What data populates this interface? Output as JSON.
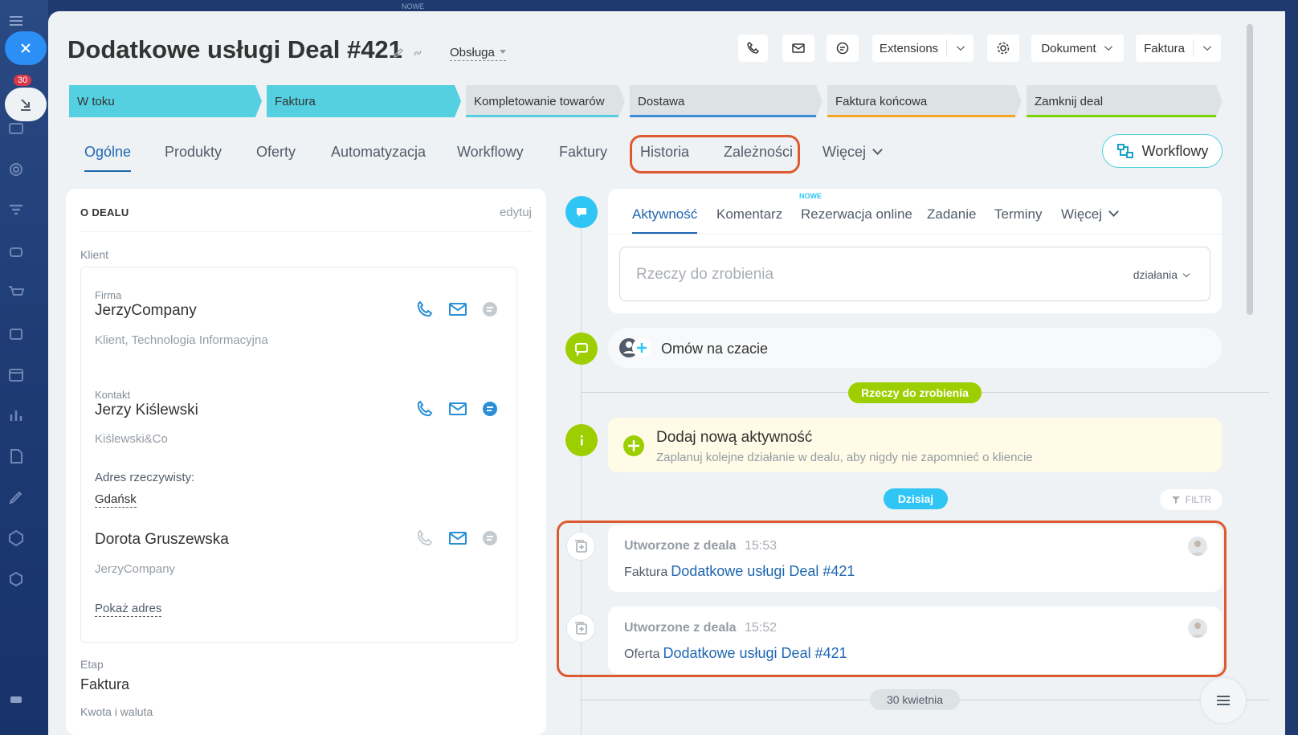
{
  "topbar": {
    "nowe_label": "NOWE"
  },
  "leftbar": {
    "notifications_count": "30"
  },
  "header": {
    "title": "Dodatkowe usługi Deal #421",
    "category": "Obsługa",
    "extensions_label": "Extensions",
    "document_label": "Dokument",
    "invoice_label": "Faktura"
  },
  "stages": [
    {
      "label": "W toku",
      "state": "done",
      "color": "#55d0e0"
    },
    {
      "label": "Faktura",
      "state": "current",
      "color": "#55d0e0"
    },
    {
      "label": "Kompletowanie towarów",
      "state": "todo",
      "color": "#55d0e0"
    },
    {
      "label": "Dostawa",
      "state": "todo",
      "color": "#3b8ed6"
    },
    {
      "label": "Faktura końcowa",
      "state": "todo",
      "color": "#f5a623"
    },
    {
      "label": "Zamknij deal",
      "state": "todo",
      "color": "#7bd500"
    }
  ],
  "tabs": [
    "Ogólne",
    "Produkty",
    "Oferty",
    "Automatyzacja",
    "Workflowy",
    "Faktury",
    "Historia",
    "Zależności",
    "Więcej"
  ],
  "workflow_button": "Workflowy",
  "about": {
    "heading": "O DEALU",
    "edit": "edytuj",
    "client_label": "Klient",
    "company_label": "Firma",
    "company_name": "JerzyCompany",
    "company_desc": "Klient, Technologia Informacyjna",
    "contact_label": "Kontakt",
    "contact_name": "Jerzy Kiślewski",
    "contact_company": "Kiślewski&Co",
    "address_label": "Adres rzeczywisty:",
    "address_value": "Gdańsk",
    "contact2_name": "Dorota Gruszewska",
    "contact2_company": "JerzyCompany",
    "show_address": "Pokaż adres",
    "stage_label": "Etap",
    "stage_value": "Faktura",
    "next_label": "Kwota i waluta"
  },
  "activity": {
    "tabs": [
      "Aktywność",
      "Komentarz",
      "Rezerwacja online",
      "Zadanie",
      "Terminy",
      "Więcej"
    ],
    "nowe": "NOWE",
    "placeholder": "Rzeczy do zrobienia",
    "actions": "działania",
    "chat": "Omów na czacie",
    "todo_pill": "Rzeczy do zrobienia",
    "new_title": "Dodaj nową aktywność",
    "new_sub": "Zaplanuj kolejne działanie w dealu, aby nigdy nie zapomnieć o kliencie",
    "today": "Dzisiaj",
    "filter": "FILTR",
    "history": [
      {
        "title": "Utworzone z deala",
        "time": "15:53",
        "type": "Faktura",
        "link": "Dodatkowe usługi Deal #421"
      },
      {
        "title": "Utworzone z deala",
        "time": "15:52",
        "type": "Oferta",
        "link": "Dodatkowe usługi Deal #421"
      }
    ],
    "date_pill": "30 kwietnia"
  }
}
